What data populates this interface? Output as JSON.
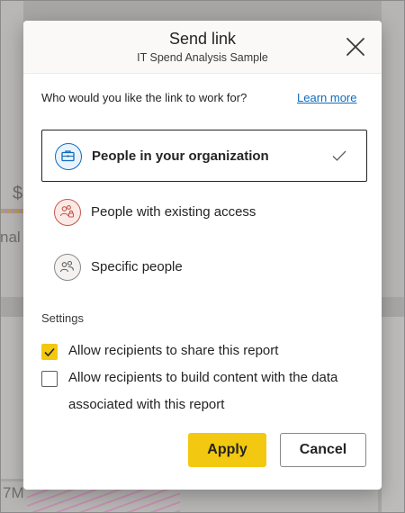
{
  "background": {
    "dollar_fragment": "$",
    "label_fragment": "nal",
    "axis_fragment": "7M"
  },
  "dialog": {
    "title": "Send link",
    "subtitle": "IT Spend Analysis Sample",
    "close_icon": "close-icon"
  },
  "question": {
    "text": "Who would you like the link to work for?",
    "learn_more": "Learn more"
  },
  "options": [
    {
      "label": "People in your organization",
      "icon": "briefcase-icon",
      "selected": true,
      "accent": "#0f6cbd"
    },
    {
      "label": "People with existing access",
      "icon": "people-lock-icon",
      "selected": false,
      "accent": "#c4584b"
    },
    {
      "label": "Specific people",
      "icon": "people-icon",
      "selected": false,
      "accent": "#605e5c"
    }
  ],
  "settings": {
    "heading": "Settings",
    "items": [
      {
        "label": "Allow recipients to share this report",
        "checked": true
      },
      {
        "label": "Allow recipients to build content with the data associated with this report",
        "checked": false
      }
    ]
  },
  "buttons": {
    "apply": "Apply",
    "cancel": "Cancel"
  },
  "colors": {
    "accent_yellow": "#f2c811",
    "link_blue": "#0f6cbd",
    "text": "#252423",
    "overlay": "#a7a6a5"
  }
}
